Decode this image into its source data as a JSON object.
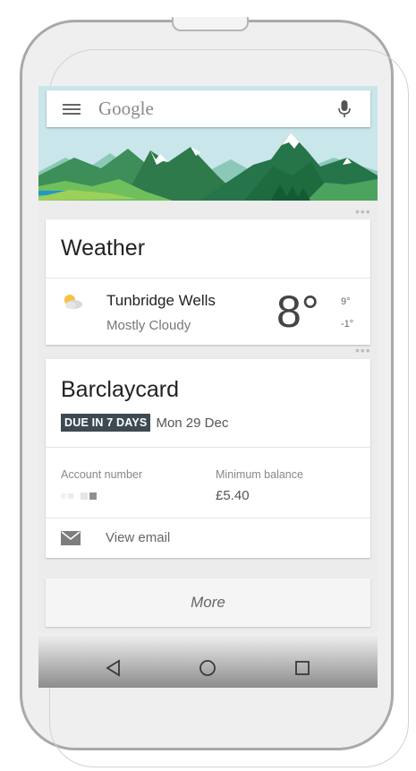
{
  "search": {
    "placeholder": "Google"
  },
  "weather_card": {
    "title": "Weather",
    "location": "Tunbridge Wells",
    "condition": "Mostly Cloudy",
    "temperature": "8°",
    "high": "9°",
    "low": "-1°",
    "icon": "partly-cloudy-icon"
  },
  "barclaycard_card": {
    "title": "Barclaycard",
    "due_badge": "DUE IN 7 DAYS",
    "due_date": "Mon 29 Dec",
    "account_number_label": "Account number",
    "minimum_balance_label": "Minimum balance",
    "minimum_balance_value": "£5.40",
    "view_email_label": "View email"
  },
  "more_button": {
    "label": "More"
  },
  "colors": {
    "badge_bg": "#3d4a52",
    "sky": "#c9e6ea",
    "mountain_dark": "#2e7d4a",
    "mountain_light": "#4caf50",
    "snow": "#ffffff",
    "water": "#2196c8"
  },
  "navigation": {
    "icons": [
      "back-icon",
      "home-icon",
      "recents-icon"
    ]
  }
}
